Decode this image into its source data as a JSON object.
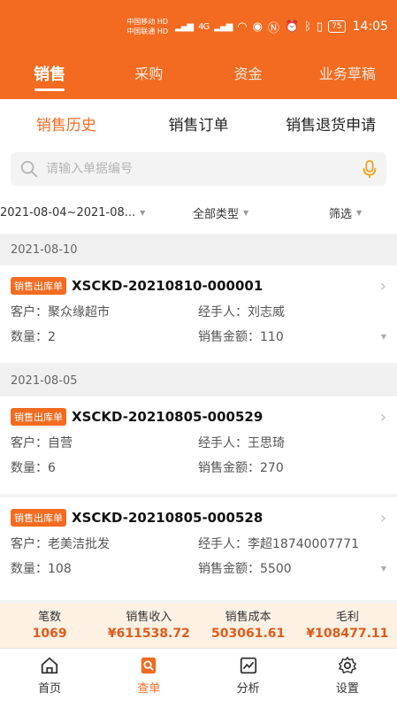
{
  "status_bar": {
    "carrier1": "中国移动",
    "carrier2": "中国联通",
    "hd": "HD",
    "network": "4G",
    "battery": "75",
    "time": "14:05"
  },
  "main_tabs": [
    {
      "label": "销售",
      "active": true
    },
    {
      "label": "采购",
      "active": false
    },
    {
      "label": "资金",
      "active": false
    },
    {
      "label": "业务草稿",
      "active": false
    }
  ],
  "sub_tabs": [
    {
      "label": "销售历史",
      "active": true
    },
    {
      "label": "销售订单",
      "active": false
    },
    {
      "label": "销售退货申请",
      "active": false
    }
  ],
  "search": {
    "placeholder": "请输入单据编号",
    "icon": "search-icon",
    "voice_icon": "microphone-icon"
  },
  "filters": {
    "date_range": "2021-08-04~2021-08...",
    "type": "全部类型",
    "filter": "筛选"
  },
  "groups": [
    {
      "date": "2021-08-10",
      "records": [
        {
          "badge": "销售出库单",
          "doc_no": "XSCKD-20210810-000001",
          "customer_label": "客户：",
          "customer": "聚众缘超市",
          "handler_label": "经手人：",
          "handler": "刘志威",
          "qty_label": "数量：",
          "qty": "2",
          "amount_label": "销售金额：",
          "amount": "110"
        }
      ]
    },
    {
      "date": "2021-08-05",
      "records": [
        {
          "badge": "销售出库单",
          "doc_no": "XSCKD-20210805-000529",
          "customer_label": "客户：",
          "customer": "自营",
          "handler_label": "经手人：",
          "handler": "王思琦",
          "qty_label": "数量：",
          "qty": "6",
          "amount_label": "销售金额：",
          "amount": "270"
        },
        {
          "badge": "销售出库单",
          "doc_no": "XSCKD-20210805-000528",
          "customer_label": "客户：",
          "customer": "老美洁批发",
          "handler_label": "经手人：",
          "handler": "李超18740007771",
          "qty_label": "数量：",
          "qty": "108",
          "amount_label": "销售金额：",
          "amount": "5500"
        }
      ]
    }
  ],
  "summary": [
    {
      "label": "笔数",
      "value": "1069"
    },
    {
      "label": "销售收入",
      "value": "¥611538.72"
    },
    {
      "label": "销售成本",
      "value": "503061.61"
    },
    {
      "label": "毛利",
      "value": "¥108477.11"
    }
  ],
  "bottom_nav": [
    {
      "label": "首页",
      "icon": "home-icon",
      "active": false
    },
    {
      "label": "查单",
      "icon": "order-search-icon",
      "active": true
    },
    {
      "label": "分析",
      "icon": "chart-icon",
      "active": false
    },
    {
      "label": "设置",
      "icon": "gear-icon",
      "active": false
    }
  ],
  "colors": {
    "accent": "#f36b21",
    "summary_bg": "#fdf1e4",
    "value_red": "#e35a1a"
  }
}
